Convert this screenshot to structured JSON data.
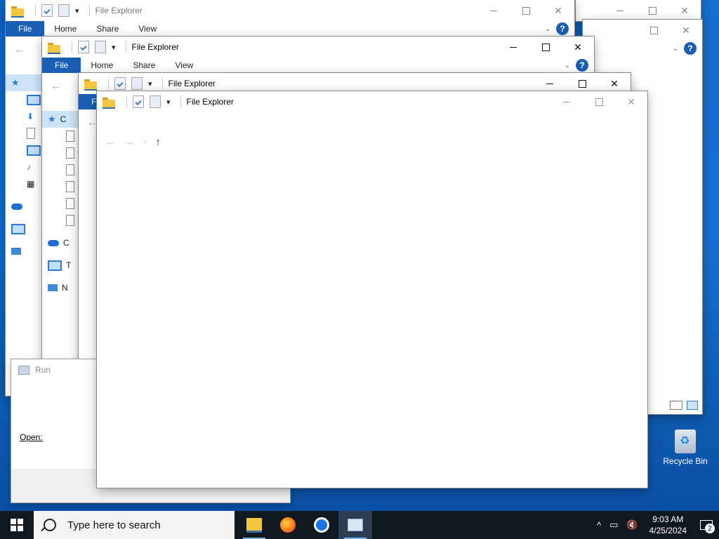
{
  "windows": {
    "w1": {
      "title": "File Explorer",
      "tabs": [
        "File",
        "Home",
        "Share",
        "View"
      ]
    },
    "w2": {
      "title": "File Explorer",
      "tabs": [
        "File",
        "Home",
        "Share",
        "View"
      ]
    },
    "w3": {
      "title": "File Explorer",
      "file_tab_partial": "F"
    },
    "w4": {
      "title": "File Explorer"
    },
    "sidebar_partial_letters": {
      "quick_access": "C",
      "onedrive": "C",
      "this_pc": "T",
      "network": "N"
    }
  },
  "run_dialog": {
    "title": "Run",
    "open_label": "Open:"
  },
  "desktop": {
    "recycle_bin_label": "Recycle Bin"
  },
  "taskbar": {
    "search_placeholder": "Type here to search",
    "time": "9:03 AM",
    "date": "4/25/2024",
    "notification_count": "2"
  }
}
